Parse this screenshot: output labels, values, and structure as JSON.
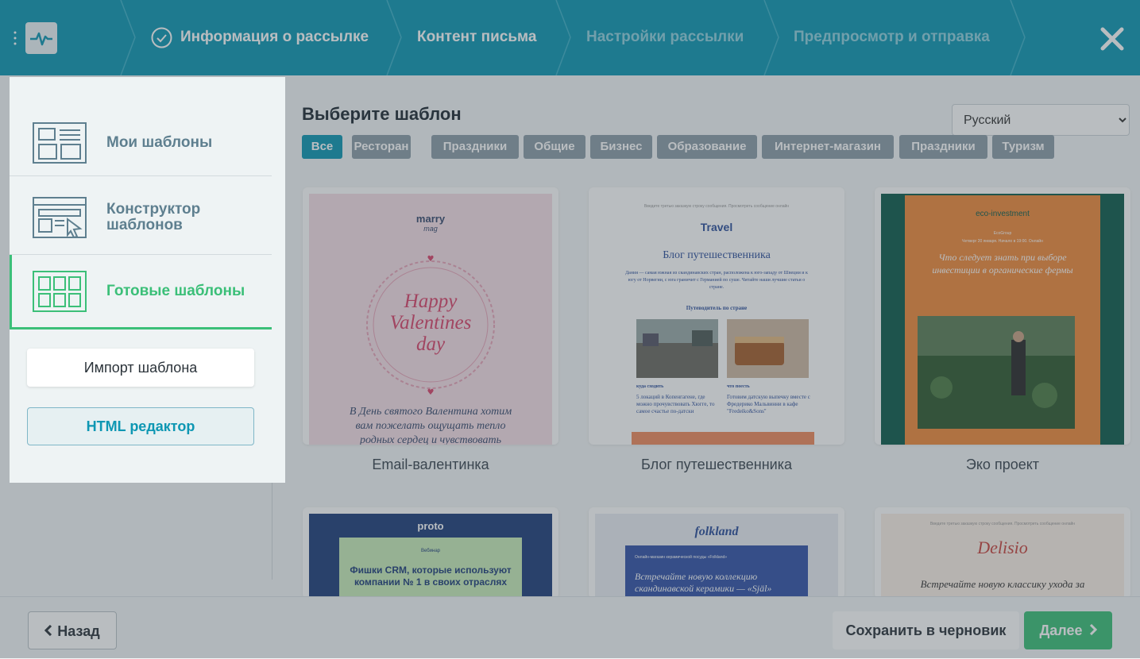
{
  "header": {
    "steps": [
      {
        "label": "Информация о рассылке",
        "state": "done"
      },
      {
        "label": "Контент письма",
        "state": "current"
      },
      {
        "label": "Настройки рассылки",
        "state": "upcoming"
      },
      {
        "label": "Предпросмотр и отправка",
        "state": "upcoming"
      }
    ],
    "close_icon": "close-icon",
    "logo_icon": "pulse-icon",
    "menu_icon": "vertical-dots-icon"
  },
  "sidebar": {
    "items": [
      {
        "label": "Мои шаблоны",
        "icon": "layout-icon"
      },
      {
        "label": "Конструктор шаблонов",
        "icon": "builder-icon"
      },
      {
        "label": "Готовые шаблоны",
        "icon": "grid-icon",
        "active": true
      }
    ],
    "import_label": "Импорт шаблона",
    "html_label": "HTML редактор"
  },
  "main": {
    "title": "Выберите шаблон",
    "language": {
      "selected": "Русский"
    },
    "tags": [
      "Все",
      "Ресторан",
      "Праздники",
      "Общие",
      "Бизнес",
      "Образование",
      "Интернет-магазин",
      "Праздники",
      "Туризм"
    ],
    "templates": [
      {
        "name": "Email-валентинка",
        "brand": "marry",
        "brand_sub": "mag",
        "heading": "Happy Valentines day",
        "body": "В День святого Валентина хотим вам пожелать ощущать тепло родных сердец и чувствовать"
      },
      {
        "name": "Блог путешественника",
        "brand": "Travel",
        "preheader": "Введите третью заказкую строку сообщения. Просмотреть сообщение онлайн",
        "heading": "Блог путешественника",
        "intro": "Дания — самая южная из скандинавских стран, расположена к юго-западу от Швеции и к югу от Норвегии, с юга граничит с Германией по суше. Читайте наши лучшие статьи о стране.",
        "section": "Путеводитель по стране",
        "col1_title": "куда сходить",
        "col1_text": "5 локаций в Копенгагене, где можно прочувствовать Хюгге, то самое счастье по-датски",
        "col2_title": "что поесть",
        "col2_text": "Готовим датскую выпечку вместе с Фредерико Мальвинни в кафе \"Fredeiko&Sons\""
      },
      {
        "name": "Эко проект",
        "brand": "eco-investment",
        "brand_sub": "EcoGroup",
        "date": "Четверг 20 января. Начало в 19:00. Онлайн",
        "heading": "Что следует знать при выборе инвестиции в органические фермы"
      },
      {
        "brand": "proto",
        "label": "Вебинар",
        "heading": "Фишки CRM, которые используют компании № 1 в своих отраслях"
      },
      {
        "brand": "folkland",
        "small": "Онлайн-магазин керамической посуды «Folkland»",
        "heading": "Встречайте новую коллекцию скандинавской керамики — «Själ»"
      },
      {
        "preheader": "Введите третью заказкую строку сообщения. Просмотреть сообщение онлайн",
        "brand": "Delisio",
        "heading": "Встречайте новую классику ухода за кожей"
      }
    ]
  },
  "footer": {
    "back_label": "Назад",
    "save_label": "Сохранить в черновик",
    "next_label": "Далее"
  },
  "colors": {
    "accent": "#0e97b3",
    "success": "#3bbf78",
    "tag": "#8c9da8"
  }
}
